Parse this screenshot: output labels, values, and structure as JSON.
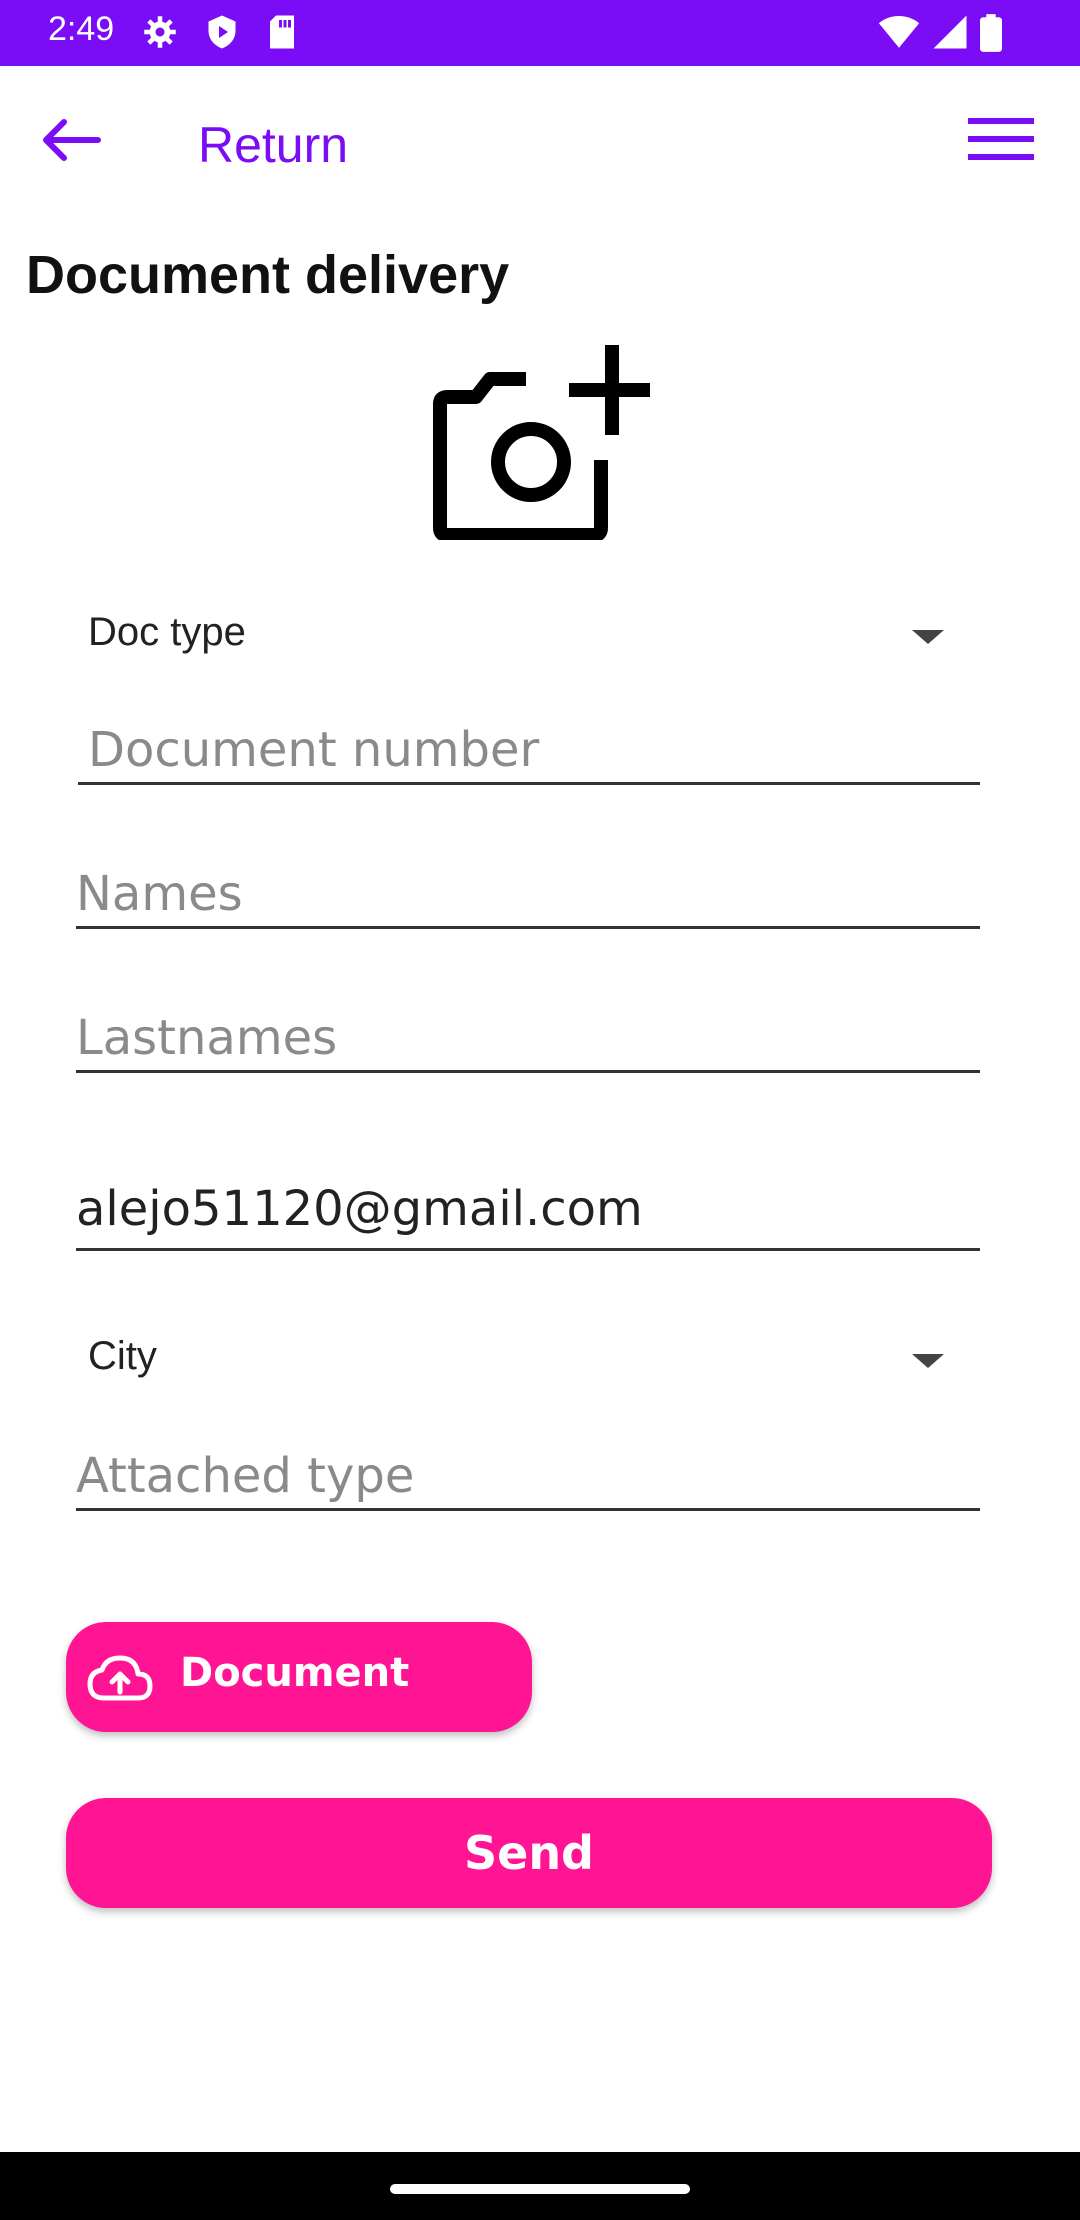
{
  "status_bar": {
    "time": "2:49",
    "icons": [
      "gear-icon",
      "shield-play-icon",
      "sd-card-icon",
      "wifi-icon",
      "signal-icon",
      "battery-icon"
    ]
  },
  "app_bar": {
    "title": "Return",
    "back_icon": "arrow-left-icon",
    "menu_icon": "hamburger-menu-icon"
  },
  "page": {
    "title": "Document delivery",
    "camera_icon": "add-photo-icon"
  },
  "form": {
    "doc_type": {
      "selected": "Doc type"
    },
    "document_number": {
      "value": "",
      "placeholder": "Document number"
    },
    "names": {
      "value": "",
      "placeholder": "Names"
    },
    "lastnames": {
      "value": "",
      "placeholder": "Lastnames"
    },
    "email": {
      "value": "alejo51120@gmail.com",
      "placeholder": ""
    },
    "city": {
      "selected": "City"
    },
    "attached_type": {
      "value": "",
      "placeholder": "Attached type"
    }
  },
  "buttons": {
    "upload_label": "Document",
    "send_label": "Send"
  },
  "colors": {
    "primary": "#7a0cf6",
    "accent": "#ff1493"
  }
}
